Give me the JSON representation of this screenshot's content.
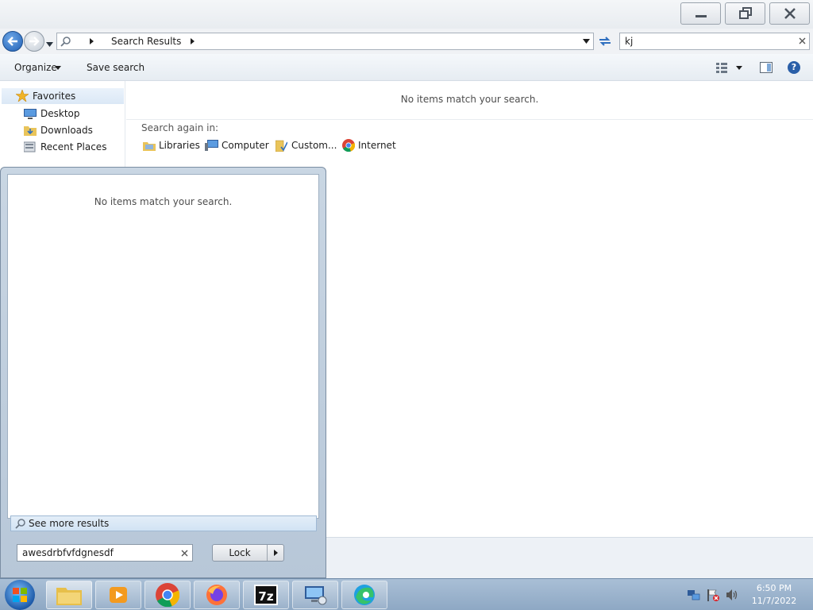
{
  "window": {
    "buttons": {
      "minimize": "minimize-icon",
      "restore": "restore-icon",
      "close": "close-icon"
    }
  },
  "address_bar": {
    "breadcrumb": "Search Results",
    "search_value": "kj"
  },
  "toolbar": {
    "organize_label": "Organize",
    "save_search_label": "Save search"
  },
  "navigation": {
    "favorites_label": "Favorites",
    "items": [
      {
        "label": "Desktop",
        "icon": "desktop-icon"
      },
      {
        "label": "Downloads",
        "icon": "downloads-folder-icon"
      },
      {
        "label": "Recent Places",
        "icon": "recent-places-icon"
      }
    ]
  },
  "content": {
    "empty_message": "No items match your search.",
    "search_again_label": "Search again in:",
    "search_locations": [
      {
        "label": "Libraries",
        "icon": "libraries-icon"
      },
      {
        "label": "Computer",
        "icon": "computer-icon"
      },
      {
        "label": "Custom...",
        "icon": "custom-folder-icon"
      },
      {
        "label": "Internet",
        "icon": "chrome-icon"
      }
    ]
  },
  "start_menu": {
    "empty_message": "No items match your search.",
    "see_more_label": "See more results",
    "search_value": "awesdrbfvfdgnesdf",
    "power_button_label": "Lock"
  },
  "taskbar": {
    "apps": [
      "windows-explorer-icon",
      "media-player-icon",
      "chrome-icon",
      "firefox-icon",
      "7zip-icon",
      "remote-desktop-icon",
      "edge-icon"
    ],
    "clock_time": "6:50 PM",
    "clock_date": "11/7/2022"
  },
  "colors": {
    "accent": "#2f6fbf",
    "taskbar": "#9fb6cf",
    "start_menu": "#c1cfdd"
  }
}
